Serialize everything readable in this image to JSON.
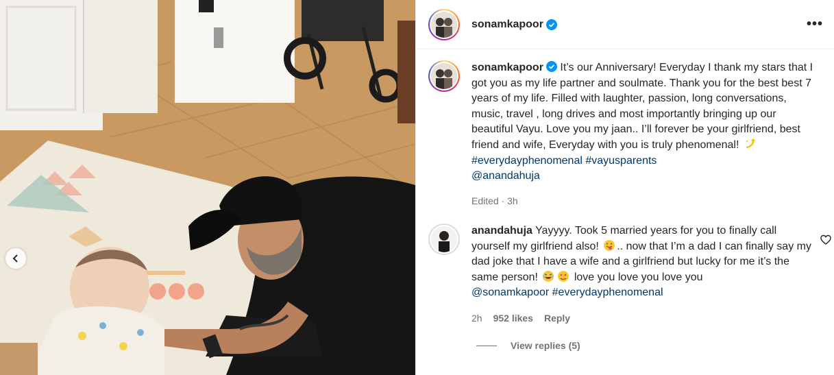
{
  "post": {
    "author": "sonamkapoor",
    "caption_text": " It’s our Anniversary! Everyday I thank my stars that I got you as my life partner and soulmate. Thank you for the best best 7 years of my life. Filled with laughter, passion, long conversations, music, travel , long drives and most importantly bringing up our beautiful Vayu. Love you my jaan.. I’ll forever be your girlfriend, best friend and wife, Everyday with you is truly phenomenal! ",
    "hashtag_1": "#everydayphenomenal",
    "hashtag_2": "#vayusparents",
    "mention": "@anandahuja",
    "edited_time": "Edited · 3h",
    "more_label": "•••"
  },
  "comments": [
    {
      "author": "anandahuja",
      "text_1": " Yayyyy. Took 5 married years for you to finally call yourself my girlfriend also! ",
      "text_2": ".. now that I’m a dad I can finally say my dad joke that I have a wife and a girlfriend but lucky for me it’s the same person! ",
      "text_3": " love you love you love you",
      "mention": "@sonamkapoor",
      "hashtag": "#everydayphenomenal",
      "time": "2h",
      "likes": "952 likes",
      "reply_label": "Reply"
    }
  ],
  "view_replies": "View replies (5)",
  "colors": {
    "link": "#00376b",
    "muted": "#737373",
    "verified": "#0095f6"
  },
  "icons": [
    "verified-badge-icon",
    "more-options-icon",
    "heart-icon",
    "carousel-prev-icon",
    "emoji-sparkle",
    "emoji-tongue",
    "emoji-laughing",
    "emoji-heart-eyes"
  ]
}
